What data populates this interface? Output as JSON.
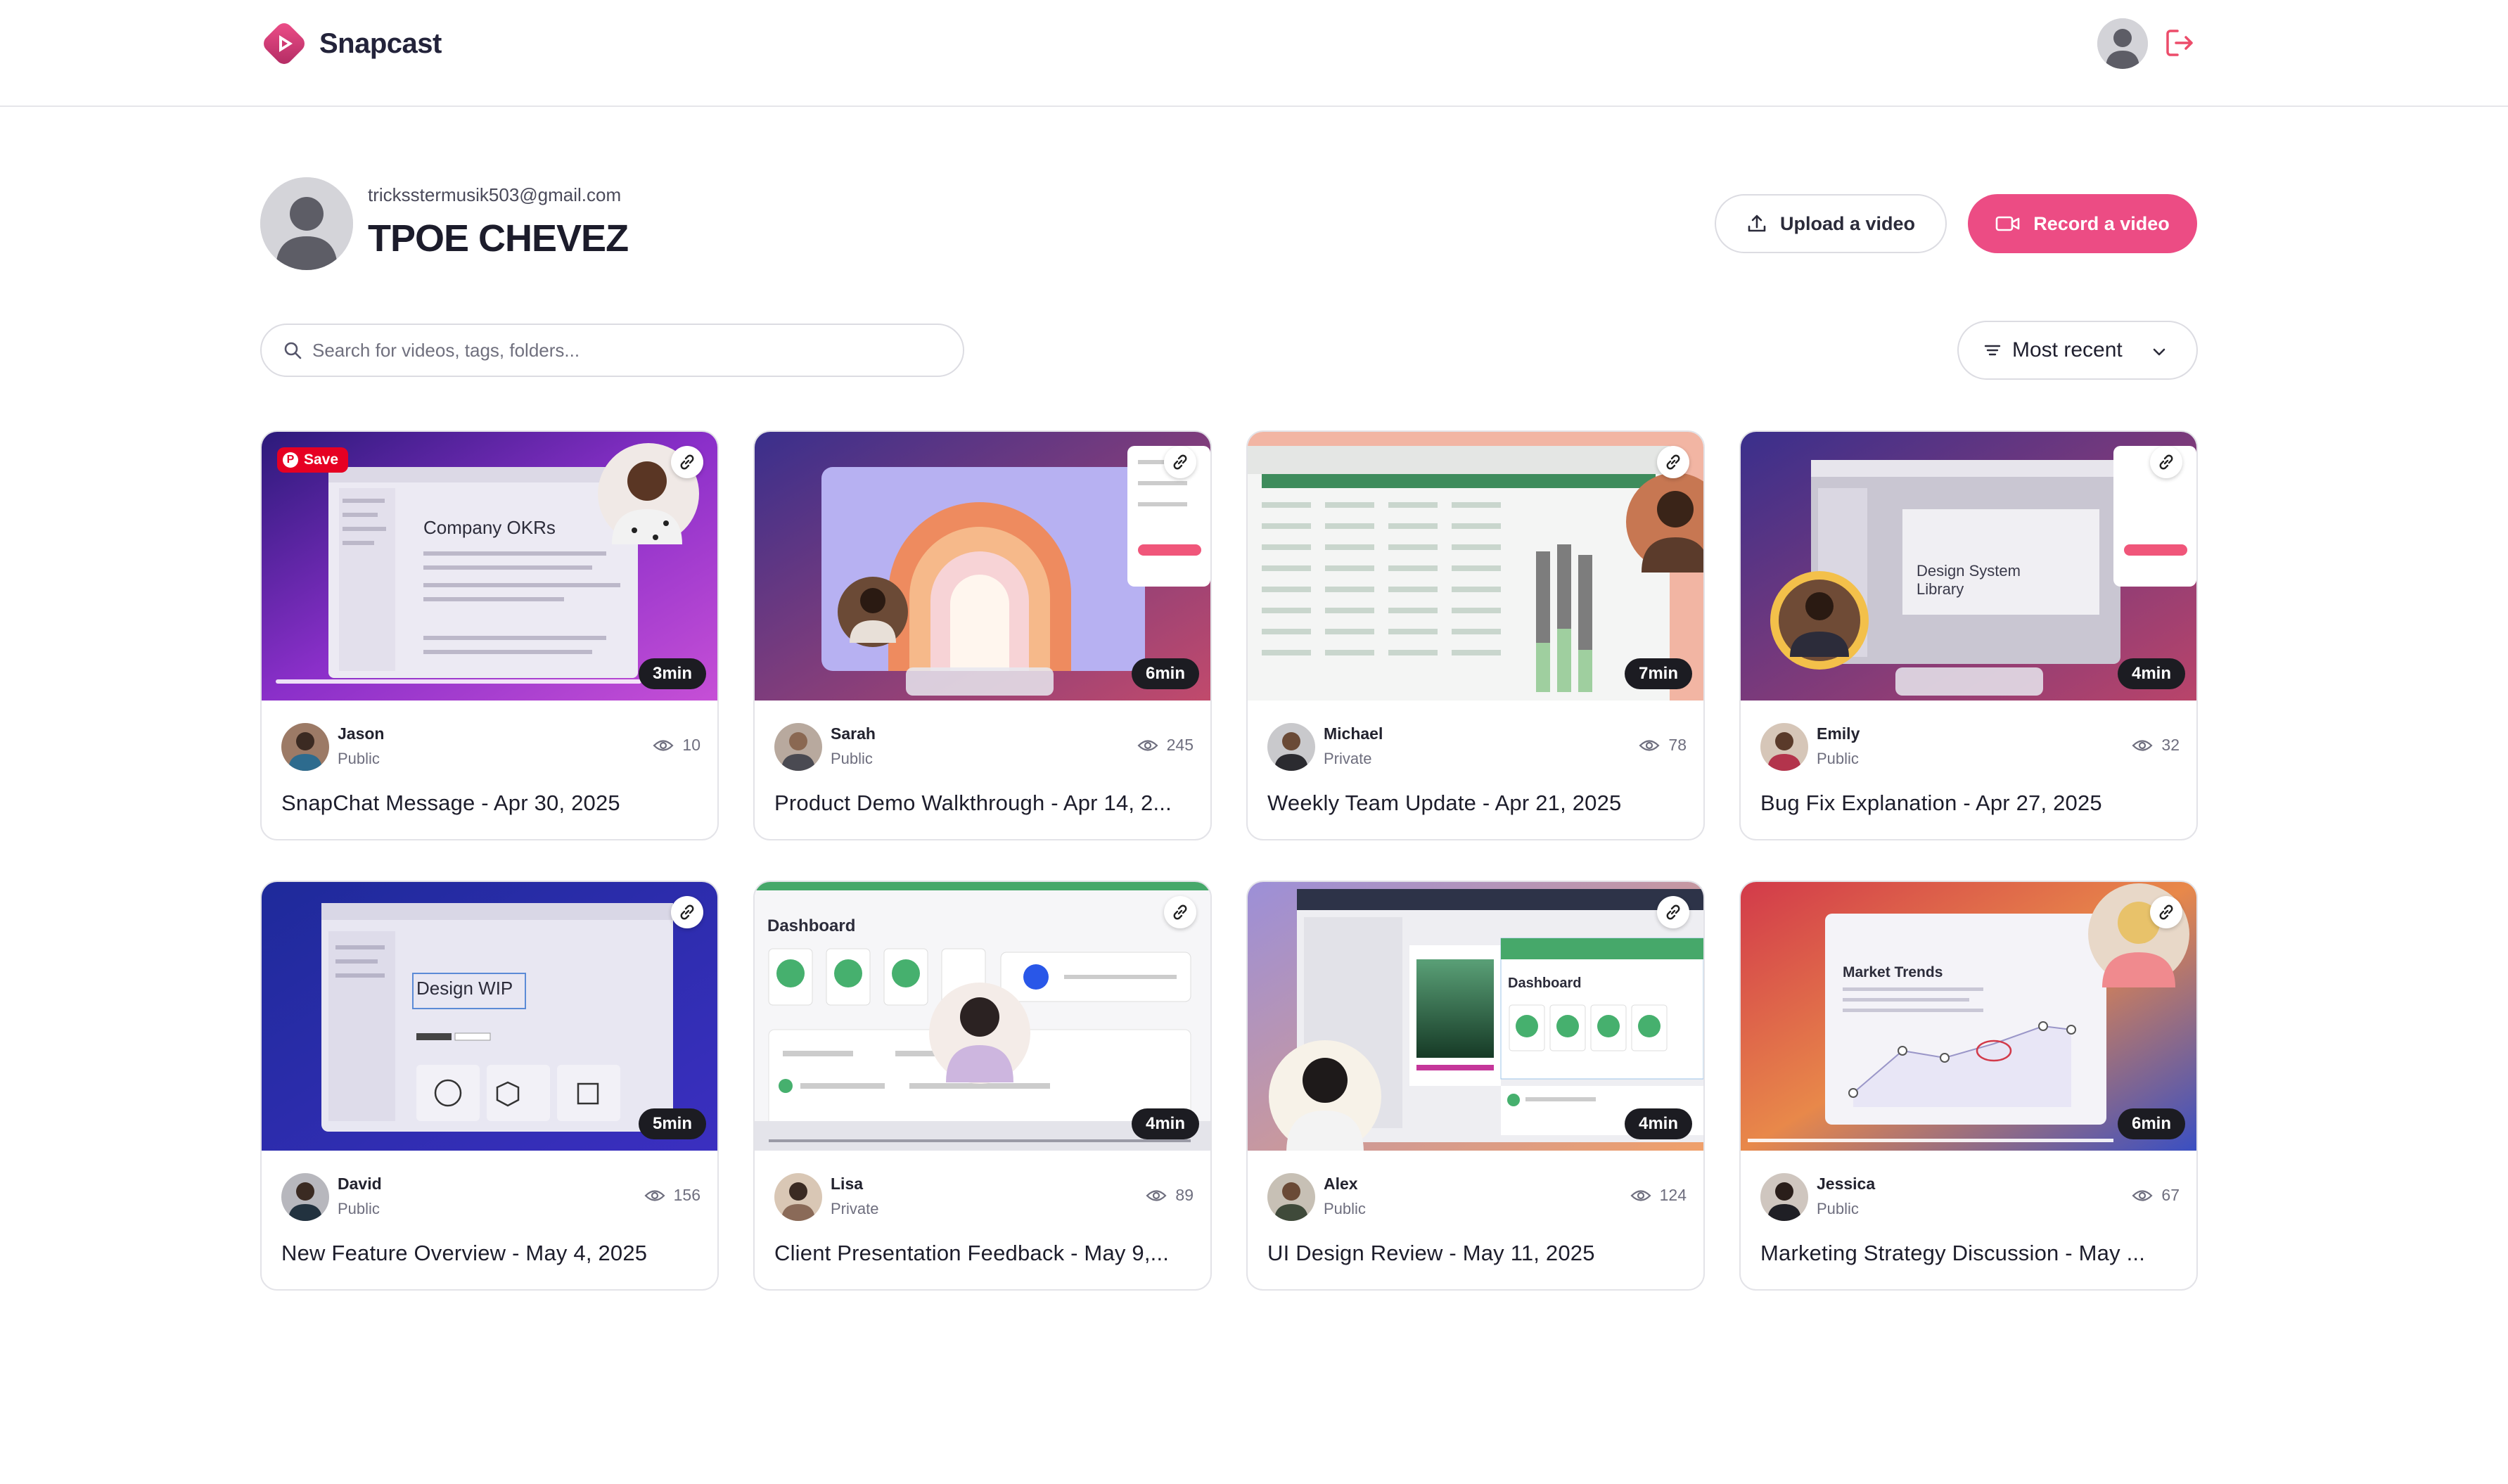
{
  "brand": {
    "name": "Snapcast",
    "accent": "#ec4c84"
  },
  "nav": {
    "avatar_icon": "user-avatar-icon",
    "logout_icon": "logout-icon"
  },
  "profile": {
    "email": "tricksstermusik503@gmail.com",
    "name": "TPOE CHEVEZ"
  },
  "actions": {
    "upload_label": "Upload a video",
    "record_label": "Record a video"
  },
  "search": {
    "placeholder": "Search for videos, tags, folders..."
  },
  "sort": {
    "label": "Most recent"
  },
  "videos": [
    {
      "author": "Jason",
      "visibility": "Public",
      "views": "10",
      "duration": "3min",
      "title": "SnapChat Message - Apr 30, 2025",
      "save_label": "Save"
    },
    {
      "author": "Sarah",
      "visibility": "Public",
      "views": "245",
      "duration": "6min",
      "title": "Product Demo Walkthrough - Apr 14, 2..."
    },
    {
      "author": "Michael",
      "visibility": "Private",
      "views": "78",
      "duration": "7min",
      "title": "Weekly Team Update - Apr 21, 2025"
    },
    {
      "author": "Emily",
      "visibility": "Public",
      "views": "32",
      "duration": "4min",
      "title": "Bug Fix Explanation - Apr 27, 2025",
      "thumb_text": "Design System Library"
    },
    {
      "author": "David",
      "visibility": "Public",
      "views": "156",
      "duration": "5min",
      "title": "New Feature Overview - May 4, 2025",
      "thumb_text": "Design WIP"
    },
    {
      "author": "Lisa",
      "visibility": "Private",
      "views": "89",
      "duration": "4min",
      "title": "Client Presentation Feedback - May 9,...",
      "thumb_text": "Dashboard"
    },
    {
      "author": "Alex",
      "visibility": "Public",
      "views": "124",
      "duration": "4min",
      "title": "UI Design Review - May 11, 2025",
      "thumb_text": "Dashboard"
    },
    {
      "author": "Jessica",
      "visibility": "Public",
      "views": "67",
      "duration": "6min",
      "title": "Marketing Strategy Discussion - May ..."
    }
  ]
}
